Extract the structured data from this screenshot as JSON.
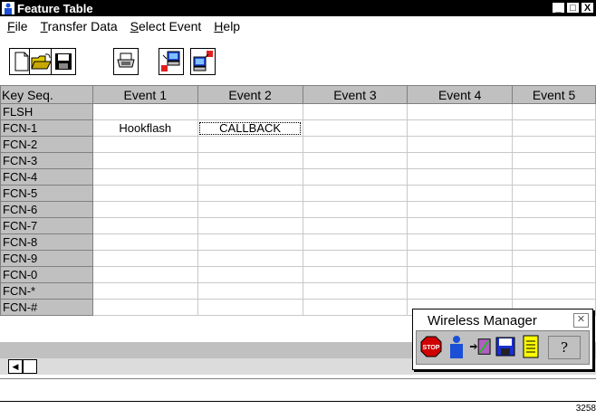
{
  "window": {
    "title": "Feature Table",
    "controls": [
      "_",
      "□",
      "X"
    ]
  },
  "menu": [
    {
      "accel": "F",
      "rest": "ile"
    },
    {
      "accel": "T",
      "rest": "ransfer Data"
    },
    {
      "accel": "S",
      "rest": "elect Event"
    },
    {
      "accel": "H",
      "rest": "elp"
    }
  ],
  "toolbar": [
    "new-file-icon",
    "open-folder-icon",
    "save-disk-icon",
    "print-icon",
    "download-to-pc-icon",
    "upload-from-pc-icon"
  ],
  "table": {
    "headers": [
      "Key Seq.",
      "Event 1",
      "Event 2",
      "Event 3",
      "Event 4",
      "Event 5"
    ],
    "rows": [
      {
        "key": "FLSH",
        "events": [
          "",
          "",
          "",
          "",
          ""
        ]
      },
      {
        "key": "FCN-1",
        "events": [
          "Hookflash",
          "CALLBACK",
          "",
          "",
          ""
        ]
      },
      {
        "key": "FCN-2",
        "events": [
          "",
          "",
          "",
          "",
          ""
        ]
      },
      {
        "key": "FCN-3",
        "events": [
          "",
          "",
          "",
          "",
          ""
        ]
      },
      {
        "key": "FCN-4",
        "events": [
          "",
          "",
          "",
          "",
          ""
        ]
      },
      {
        "key": "FCN-5",
        "events": [
          "",
          "",
          "",
          "",
          ""
        ]
      },
      {
        "key": "FCN-6",
        "events": [
          "",
          "",
          "",
          "",
          ""
        ]
      },
      {
        "key": "FCN-7",
        "events": [
          "",
          "",
          "",
          "",
          ""
        ]
      },
      {
        "key": "FCN-8",
        "events": [
          "",
          "",
          "",
          "",
          ""
        ]
      },
      {
        "key": "FCN-9",
        "events": [
          "",
          "",
          "",
          "",
          ""
        ]
      },
      {
        "key": "FCN-0",
        "events": [
          "",
          "",
          "",
          "",
          ""
        ]
      },
      {
        "key": "FCN-*",
        "events": [
          "",
          "",
          "",
          "",
          ""
        ]
      },
      {
        "key": "FCN-#",
        "events": [
          "",
          "",
          "",
          "",
          ""
        ]
      }
    ]
  },
  "wireless_manager": {
    "title": "Wireless Manager",
    "stop_label": "STOP",
    "help_glyph": "?",
    "buttons": [
      "stop-icon",
      "user-icon",
      "transfer-icon",
      "save-disk-icon",
      "notepad-icon",
      "help-icon"
    ]
  },
  "figure_number": "3258"
}
